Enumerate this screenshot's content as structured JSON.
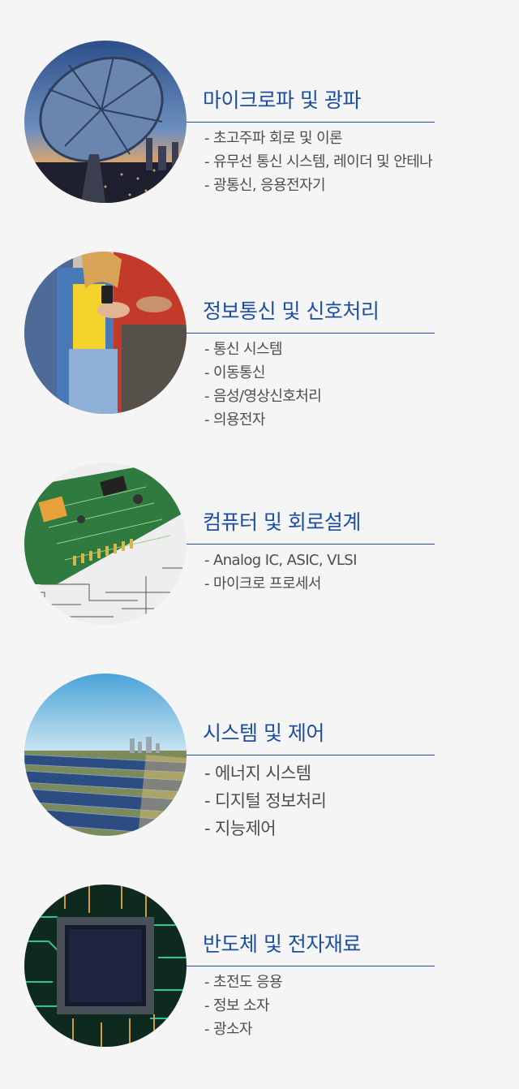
{
  "sections": [
    {
      "title": "마이크로파 및 광파",
      "image": "satellite-dish-city-night",
      "items": [
        "- 초고주파 회로 및 이론",
        "- 유무선 통신 시스템, 레이더 및 안테나",
        "- 광통신, 응용전자기"
      ]
    },
    {
      "title": "정보통신 및 신호처리",
      "image": "people-using-smartphone",
      "items": [
        "- 통신 시스템",
        "- 이동통신",
        "- 음성/영상신호처리",
        "- 의용전자"
      ]
    },
    {
      "title": "컴퓨터 및 회로설계",
      "image": "circuit-board-schematic",
      "items": [
        "- Analog IC, ASIC, VLSI",
        "- 마이크로 프로세서"
      ]
    },
    {
      "title": "시스템 및 제어",
      "image": "solar-panel-field",
      "items": [
        "- 에너지 시스템",
        "- 디지털 정보처리",
        "- 지능제어"
      ]
    },
    {
      "title": "반도체 및 전자재료",
      "image": "microchip-glowing-circuits",
      "items": [
        "- 초전도 응용",
        "- 정보 소자",
        "- 광소자"
      ]
    }
  ],
  "colors": {
    "accent": "#1c4f9e",
    "text": "#4d4d4d",
    "background": "#f5f5f5"
  }
}
